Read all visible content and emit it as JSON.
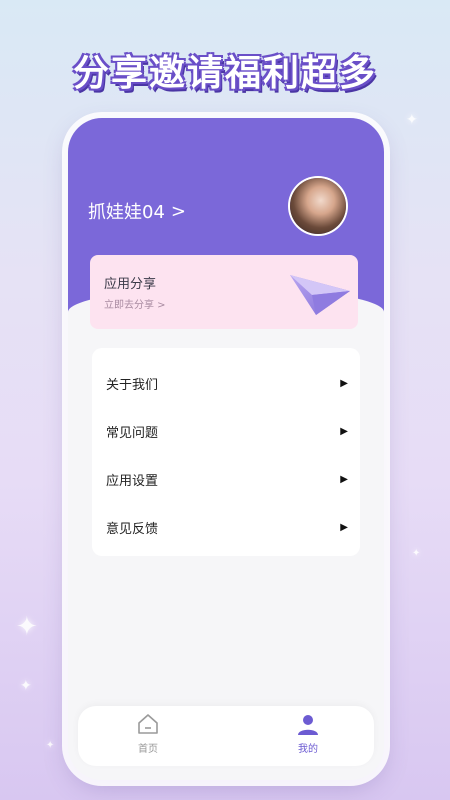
{
  "promo": {
    "title": "分享邀请福利超多"
  },
  "profile": {
    "username": "抓娃娃04",
    "chevron": ">"
  },
  "share_card": {
    "title": "应用分享",
    "subtitle": "立即去分享 >"
  },
  "menu": {
    "items": [
      {
        "label": "关于我们"
      },
      {
        "label": "常见问题"
      },
      {
        "label": "应用设置"
      },
      {
        "label": "意见反馈"
      }
    ]
  },
  "tabbar": {
    "items": [
      {
        "label": "首页",
        "icon": "home-icon",
        "active": false
      },
      {
        "label": "我的",
        "icon": "user-icon",
        "active": true
      }
    ]
  },
  "colors": {
    "header_purple": "#7b68d9",
    "share_card_bg": "#fde3f0",
    "active_tab": "#6c5bd2"
  }
}
